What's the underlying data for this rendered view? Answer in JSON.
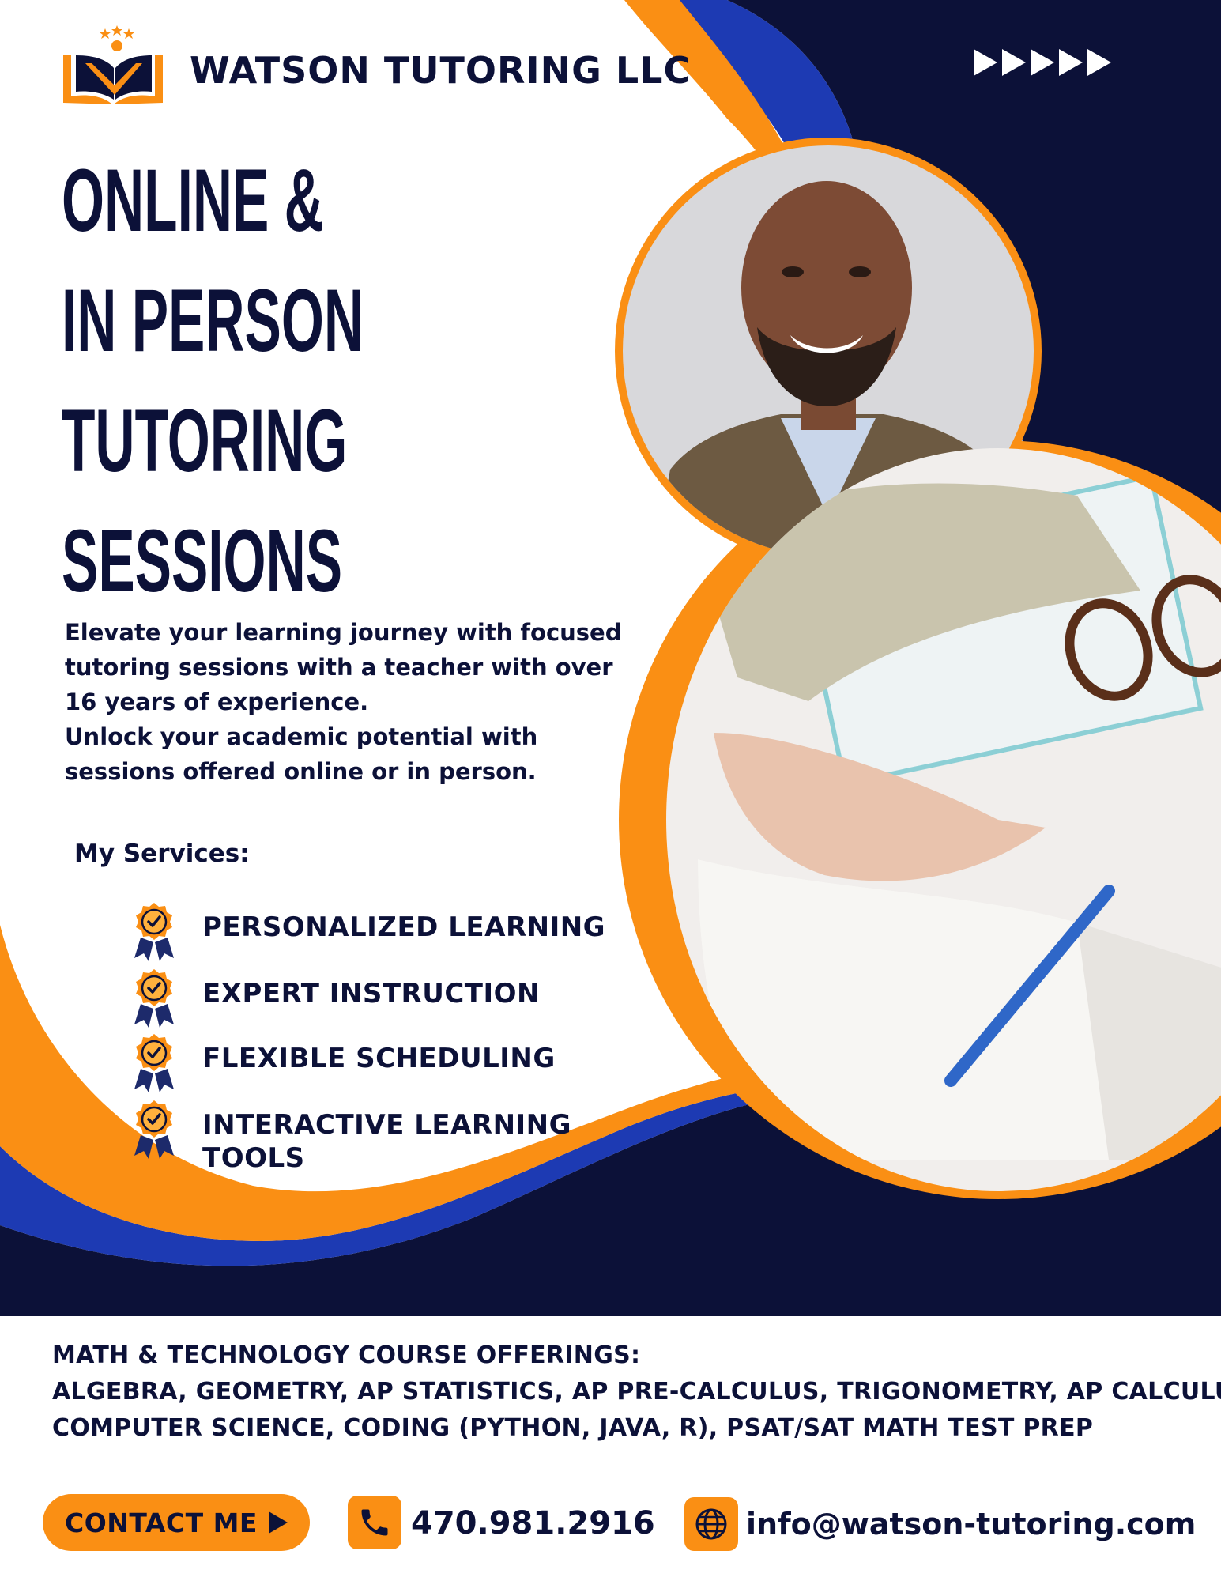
{
  "brand": {
    "name": "WATSON TUTORING LLC",
    "logo_icon": "open-book-with-stars-icon"
  },
  "headline": {
    "lines": [
      "ONLINE &",
      "IN PERSON",
      "TUTORING",
      "SESSIONS"
    ]
  },
  "intro": {
    "paragraph1": "Elevate your learning journey with focused tutoring sessions with a teacher with over 16 years of experience.",
    "paragraph2": "Unlock your academic potential with sessions offered online or in person."
  },
  "services": {
    "title": "My Services:",
    "items": [
      {
        "label": "PERSONALIZED LEARNING",
        "icon": "award-badge-check-icon"
      },
      {
        "label": "EXPERT INSTRUCTION",
        "icon": "award-badge-check-icon"
      },
      {
        "label": "FLEXIBLE SCHEDULING",
        "icon": "award-badge-check-icon"
      },
      {
        "label": "INTERACTIVE LEARNING TOOLS",
        "icon": "award-badge-check-icon"
      }
    ]
  },
  "courses": {
    "heading": "MATH & TECHNOLOGY COURSE OFFERINGS:",
    "line1": "ALGEBRA, GEOMETRY, AP STATISTICS, AP PRE-CALCULUS, TRIGONOMETRY, AP CALCULUS,",
    "line2": "COMPUTER SCIENCE, CODING (PYTHON, JAVA, R), PSAT/SAT MATH TEST PREP"
  },
  "contact": {
    "button_label": "CONTACT ME",
    "phone": "470.981.2916",
    "phone_icon": "phone-icon",
    "email": "info@watson-tutoring.com",
    "web_icon": "globe-icon"
  },
  "colors": {
    "navy": "#0c1138",
    "orange": "#fa8f14",
    "blue": "#1d3ab3",
    "white": "#ffffff"
  }
}
